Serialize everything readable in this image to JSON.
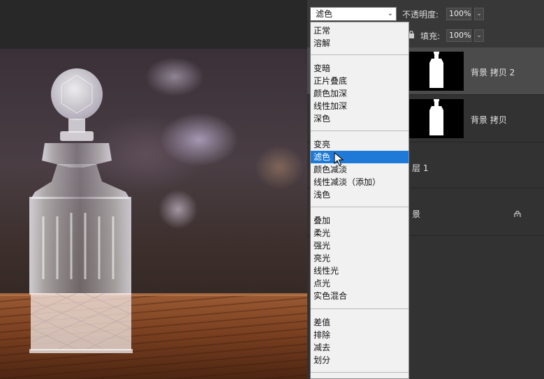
{
  "options_bar": {
    "blend_mode_value": "滤色",
    "opacity_label": "不透明度:",
    "opacity_value": "100%",
    "fill_label": "填充:",
    "fill_value": "100%"
  },
  "blend_menu": {
    "groups": [
      [
        "正常",
        "溶解"
      ],
      [
        "变暗",
        "正片叠底",
        "颜色加深",
        "线性加深",
        "深色"
      ],
      [
        "变亮",
        "滤色",
        "颜色减淡",
        "线性减淡（添加）",
        "浅色"
      ],
      [
        "叠加",
        "柔光",
        "强光",
        "亮光",
        "线性光",
        "点光",
        "实色混合"
      ],
      [
        "差值",
        "排除",
        "减去",
        "划分"
      ]
    ],
    "highlighted": "滤色"
  },
  "layers": {
    "items": [
      {
        "name": "背景 拷贝 2",
        "selected": true
      },
      {
        "name": "背景 拷贝",
        "selected": false
      },
      {
        "name_visible_fragment": "层 1"
      },
      {
        "name_visible_fragment": "景",
        "locked": true
      }
    ]
  },
  "icons": {
    "lock": "lock-icon",
    "chevron": "chevron-down-icon",
    "cursor": "pointer-cursor"
  },
  "colors": {
    "highlight": "#1e7ad6",
    "panel": "#323232",
    "selected_layer": "#4b4b4b"
  }
}
